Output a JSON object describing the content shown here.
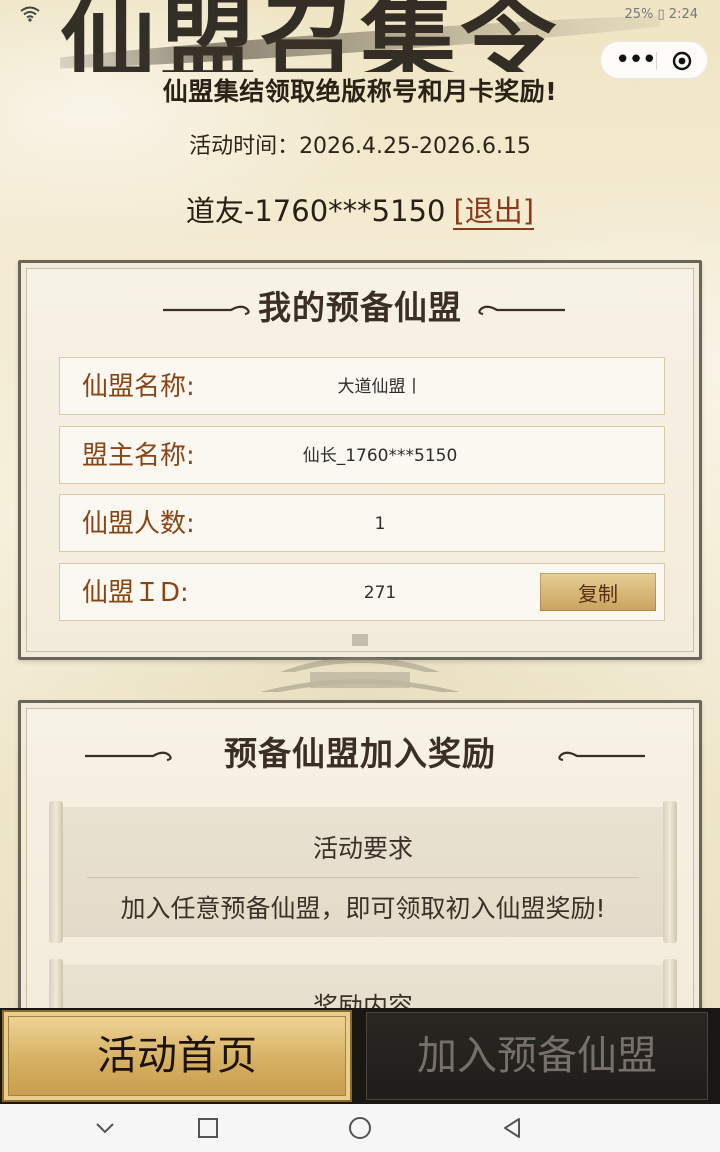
{
  "status_bar": {
    "right_text": "25% ▯ 2:24"
  },
  "banner": {
    "art_text": "仙盟召集令",
    "subtitle": "仙盟集结领取绝版称号和月卡奖励!"
  },
  "activity": {
    "time_text": "活动时间：2026.4.25-2026.6.15"
  },
  "user": {
    "greeting": "道友-1760***5150",
    "logout_label": "[退出]"
  },
  "my_alliance": {
    "title": "我的预备仙盟",
    "rows": [
      {
        "label": "仙盟名称:",
        "value": "大道仙盟丨"
      },
      {
        "label": "盟主名称:",
        "value": "仙长_1760***5150"
      },
      {
        "label": "仙盟人数:",
        "value": "1"
      },
      {
        "label": "仙盟ＩD:",
        "value": "271"
      }
    ],
    "copy_label": "复制"
  },
  "reward": {
    "title": "预备仙盟加入奖励",
    "requirement_title": "活动要求",
    "requirement_text": "加入任意预备仙盟，即可领取初入仙盟奖励!",
    "content_title": "奖励内容"
  },
  "action_bar": {
    "home_label": "活动首页",
    "join_label": "加入预备仙盟"
  },
  "icons": {
    "capsule_more": "more-dots-icon",
    "capsule_close": "target-icon",
    "nav_back": "chevron-down-icon",
    "nav_recent": "square-icon",
    "nav_home": "circle-icon",
    "nav_triangle": "triangle-back-icon"
  }
}
